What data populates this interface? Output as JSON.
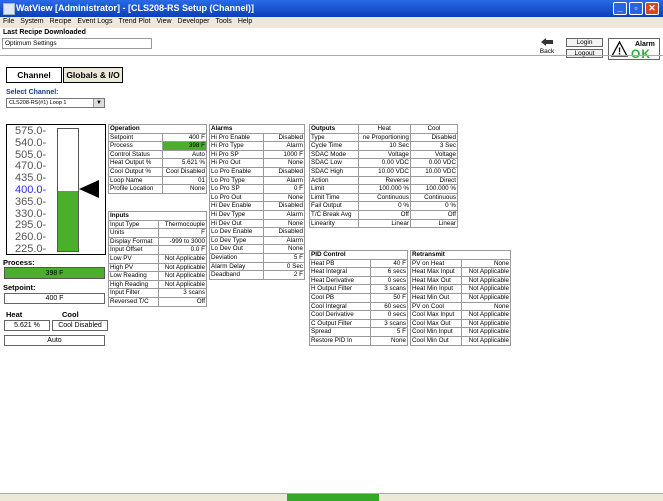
{
  "window": {
    "title": "WatView [Administrator]   - [CLS208-RS Setup (Channel)]",
    "min": "_",
    "max": "▫",
    "close": "✕"
  },
  "menu": [
    "File",
    "System",
    "Recipe",
    "Event Logs",
    "Trend Plot",
    "View",
    "Developer",
    "Tools",
    "Help"
  ],
  "recipe": {
    "label": "Last Recipe Downloaded",
    "value": "Optimum Settings"
  },
  "toolbar": {
    "back": "Back",
    "back_icon": "left-arrow-icon",
    "login": "Login",
    "logout": "Logout",
    "alarm_title": "Alarm",
    "alarm_state": "OK",
    "alarm_ok_color": "#3aa83a"
  },
  "tabs": {
    "channel": "Channel",
    "globals": "Globals & I/O"
  },
  "channel": {
    "label": "Select Channel:",
    "selected": "CLS208-RS(#1) Loop 1"
  },
  "scale": [
    "575.0-",
    "540.0-",
    "505.0-",
    "470.0-",
    "435.0-",
    "400.0-",
    "365.0-",
    "330.0-",
    "295.0-",
    "260.0-",
    "225.0-"
  ],
  "bar_fill_fraction": 0.495,
  "process": {
    "label": "Process:",
    "value": "398  F"
  },
  "setpoint": {
    "label": "Setpoint:",
    "value": "400  F"
  },
  "heat": {
    "label": "Heat",
    "value": "5.621 %"
  },
  "cool": {
    "label": "Cool",
    "value": "Cool Disabled"
  },
  "mode": "Auto",
  "operation": {
    "title": "Operation",
    "rows": [
      [
        "Setpoint",
        "400  F"
      ],
      [
        "Process",
        "398  F"
      ],
      [
        "Control Status",
        "Auto"
      ],
      [
        "Heat Output %",
        "5.621 %"
      ],
      [
        "Cool Output %",
        "Cool Disabled"
      ],
      [
        "Loop Name",
        "01"
      ],
      [
        "Profile Location",
        "None"
      ]
    ]
  },
  "inputs": {
    "title": "Inputs",
    "rows": [
      [
        "Input Type",
        "Thermocouple"
      ],
      [
        "Units",
        "F"
      ],
      [
        "Display Format",
        "-999 to 3000"
      ],
      [
        "Input Offset",
        "0.0  F"
      ],
      [
        "Low PV",
        "Not Applicable"
      ],
      [
        "High PV",
        "Not Applicable"
      ],
      [
        "Low Reading",
        "Not Applicable"
      ],
      [
        "High Reading",
        "Not Applicable"
      ],
      [
        "Input Filter",
        "3 scans"
      ],
      [
        "Reversed T/C",
        "Off"
      ]
    ]
  },
  "alarms": {
    "title": "Alarms",
    "rows": [
      [
        "Hi Pro Enable",
        "Disabled"
      ],
      [
        "Hi Pro Type",
        "Alarm"
      ],
      [
        "Hi Pro SP",
        "1000  F"
      ],
      [
        "Hi Pro Out",
        "None"
      ],
      [
        "Lo Pro Enable",
        "Disabled"
      ],
      [
        "Lo Pro Type",
        "Alarm"
      ],
      [
        "Lo Pro SP",
        "0  F"
      ],
      [
        "Lo Pro Out",
        "None"
      ],
      [
        "Hi Dev Enable",
        "Disabled"
      ],
      [
        "Hi Dev Type",
        "Alarm"
      ],
      [
        "Hi Dev Out",
        "None"
      ],
      [
        "Lo Dev Enable",
        "Disabled"
      ],
      [
        "Lo Dev Type",
        "Alarm"
      ],
      [
        "Lo Dev Out",
        "None"
      ],
      [
        "Deviation",
        "5  F"
      ],
      [
        "Alarm Delay",
        "0 Sec"
      ],
      [
        "Deadband",
        "2  F"
      ]
    ]
  },
  "outputs": {
    "title": "Outputs",
    "heat_header": "Heat",
    "cool_header": "Cool",
    "rows": [
      [
        "Type",
        "ne Proportioning",
        "Disabled"
      ],
      [
        "Cycle Time",
        "10 Sec",
        "3 Sec"
      ],
      [
        "SDAC Mode",
        "Voltage",
        "Voltage"
      ],
      [
        "SDAC Low",
        "0.00 VDC",
        "0.00 VDC"
      ],
      [
        "SDAC High",
        "10.00 VDC",
        "10.00 VDC"
      ],
      [
        "Action",
        "Reverse",
        "Direct"
      ],
      [
        "Limit",
        "100.000 %",
        "100.000 %"
      ],
      [
        "Limit Time",
        "Continuous",
        "Continuous"
      ],
      [
        "Fail Output",
        "0 %",
        "0 %"
      ],
      [
        "T/C Break Avg",
        "Off",
        "Off"
      ],
      [
        "Linearity",
        "Linear",
        "Linear"
      ]
    ]
  },
  "pid": {
    "title": "PID Control",
    "rows": [
      [
        "Heat PB",
        "40  F"
      ],
      [
        "Heat Integral",
        "6 secs"
      ],
      [
        "Heat Derivative",
        "0 secs"
      ],
      [
        "H Output Filter",
        "3 scans"
      ],
      [
        "Cool PB",
        "50  F"
      ],
      [
        "Cool Integral",
        "60 secs"
      ],
      [
        "Cool Derivative",
        "0 secs"
      ],
      [
        "C Output Filter",
        "3 scans"
      ],
      [
        "Spread",
        "5  F"
      ],
      [
        "Restore PID In",
        "None"
      ]
    ]
  },
  "retransmit": {
    "title": "Retransmit",
    "rows": [
      [
        "PV on Heat",
        "None"
      ],
      [
        "Heat Max Input",
        "Not Applicable"
      ],
      [
        "Heat Max Out",
        "Not Applicable"
      ],
      [
        "Heat Min Input",
        "Not Applicable"
      ],
      [
        "Heat Min Out",
        "Not Applicable"
      ],
      [
        "PV on Cool",
        "None"
      ],
      [
        "Cool Max Input",
        "Not Applicable"
      ],
      [
        "Cool Max Out",
        "Not Applicable"
      ],
      [
        "Cool Min Input",
        "Not Applicable"
      ],
      [
        "Cool Min Out",
        "Not Applicable"
      ]
    ]
  },
  "colors": {
    "green": "#4caf2c",
    "blue_text": "#2b2bff"
  }
}
